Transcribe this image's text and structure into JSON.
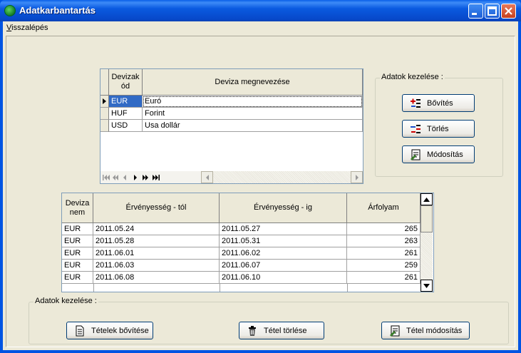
{
  "window": {
    "title": "Adatkarbantartás"
  },
  "menu": {
    "back_label_first": "V",
    "back_label_rest": "isszalépés"
  },
  "currency_grid": {
    "headers": [
      "Devizak ód",
      "Deviza megnevezése"
    ],
    "rows": [
      [
        "EUR",
        "Euró"
      ],
      [
        "HUF",
        "Forint"
      ],
      [
        "USD",
        "Usa dollár"
      ]
    ]
  },
  "top_group": {
    "label": "Adatok kezelése :",
    "add_label": "Bővítés",
    "delete_label": "Törlés",
    "modify_label": "Módosítás"
  },
  "rate_grid": {
    "headers": [
      "Deviza nem",
      "Érvényesség - tól",
      "Érvényesség - ig",
      "Árfolyam"
    ],
    "rows": [
      [
        "EUR",
        "2011.05.24",
        "2011.05.27",
        "265"
      ],
      [
        "EUR",
        "2011.05.28",
        "2011.05.31",
        "263"
      ],
      [
        "EUR",
        "2011.06.01",
        "2011.06.02",
        "261"
      ],
      [
        "EUR",
        "2011.06.03",
        "2011.06.07",
        "259"
      ],
      [
        "EUR",
        "2011.06.08",
        "2011.06.10",
        "261"
      ]
    ]
  },
  "bottom_group": {
    "label": "Adatok kezelése :",
    "add_items_label": "Tételek bővítése",
    "delete_item_label": "Tétel törlése",
    "modify_item_label": "Tétel módosítás"
  }
}
